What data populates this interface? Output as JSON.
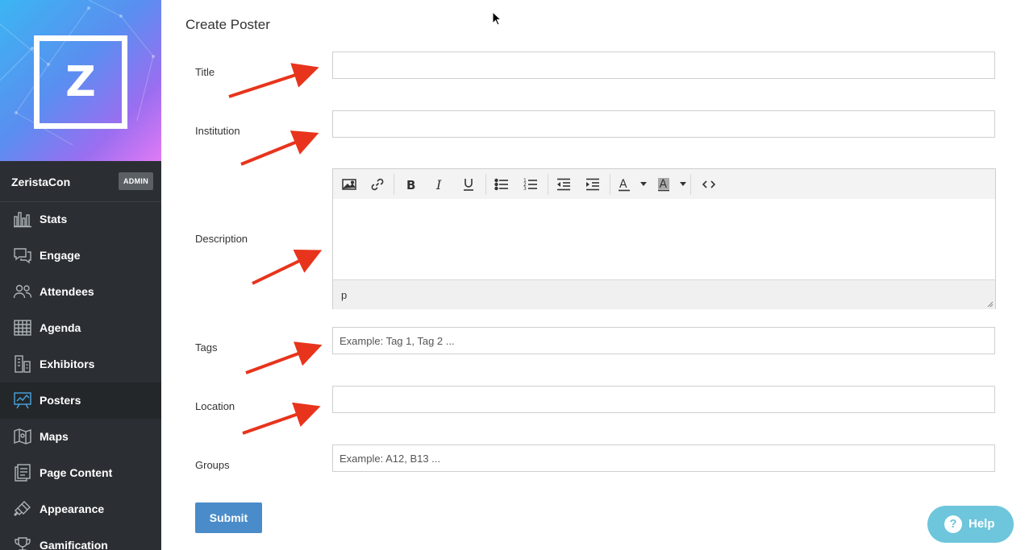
{
  "sidebar": {
    "logo_letter": "Z",
    "event_name": "ZeristaCon",
    "role_badge": "ADMIN",
    "items": [
      {
        "label": "Stats",
        "icon": "bar-chart-icon"
      },
      {
        "label": "Engage",
        "icon": "chat-bubbles-icon"
      },
      {
        "label": "Attendees",
        "icon": "people-icon"
      },
      {
        "label": "Agenda",
        "icon": "calendar-grid-icon"
      },
      {
        "label": "Exhibitors",
        "icon": "buildings-icon"
      },
      {
        "label": "Posters",
        "icon": "presentation-board-icon",
        "active": true
      },
      {
        "label": "Maps",
        "icon": "map-icon"
      },
      {
        "label": "Page Content",
        "icon": "pages-icon"
      },
      {
        "label": "Appearance",
        "icon": "paintbrush-icon"
      },
      {
        "label": "Gamification",
        "icon": "trophy-icon"
      }
    ]
  },
  "form": {
    "title": "Create Poster",
    "fields": {
      "title": {
        "label": "Title",
        "value": "",
        "placeholder": ""
      },
      "institution": {
        "label": "Institution",
        "value": "",
        "placeholder": ""
      },
      "description": {
        "label": "Description",
        "status_path": "p"
      },
      "tags": {
        "label": "Tags",
        "value": "",
        "placeholder": "Example: Tag 1, Tag 2 ..."
      },
      "location": {
        "label": "Location",
        "value": "",
        "placeholder": ""
      },
      "groups": {
        "label": "Groups",
        "value": "",
        "placeholder": "Example: A12, B13 ..."
      }
    },
    "toolbar_icons": [
      "image-icon",
      "link-icon",
      "bold-icon",
      "italic-icon",
      "underline-icon",
      "bullet-list-icon",
      "numbered-list-icon",
      "outdent-icon",
      "indent-icon",
      "text-color-icon",
      "background-color-icon",
      "source-code-icon"
    ],
    "submit_label": "Submit"
  },
  "help": {
    "label": "Help",
    "icon_glyph": "?"
  },
  "colors": {
    "sidebar_bg": "#2b2f33",
    "submit_bg": "#4a8cc9",
    "help_bg": "#5ec0d8",
    "arrow": "#e8341c"
  }
}
